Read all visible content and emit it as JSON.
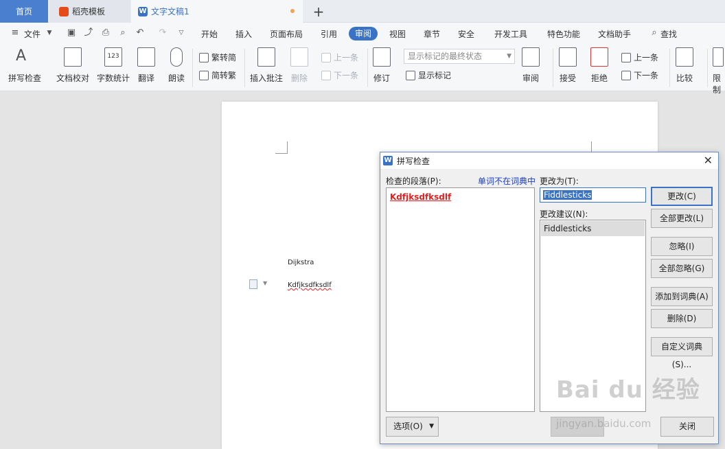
{
  "tabs": {
    "home": "首页",
    "template": "稻壳模板",
    "document": "文字文稿1",
    "add": "+"
  },
  "menu": {
    "file": "文件",
    "items": [
      "开始",
      "插入",
      "页面布局",
      "引用",
      "审阅",
      "视图",
      "章节",
      "安全",
      "开发工具",
      "特色功能",
      "文档助手"
    ],
    "search": "查找"
  },
  "ribbon": {
    "spell_check": "拼写检查",
    "doc_proof": "文档校对",
    "word_count": "字数统计",
    "translate": "翻译",
    "read_aloud": "朗读",
    "trad_to_simp": "繁转简",
    "simp_to_trad": "简转繁",
    "insert_comment": "插入批注",
    "delete": "删除",
    "prev": "上一条",
    "next": "下一条",
    "revise": "修订",
    "markup_select": "显示标记的最终状态",
    "show_markup": "显示标记",
    "review": "审阅",
    "accept": "接受",
    "reject": "拒绝",
    "prev2": "上一条",
    "next2": "下一条",
    "compare": "比较",
    "restrict": "限制"
  },
  "document": {
    "word1": "Dijkstra",
    "word2": "Kdfjksdfksdlf"
  },
  "dialog": {
    "title": "拼写检查",
    "checked_paragraph": "检查的段落(P):",
    "not_in_dict": "单词不在词典中",
    "change_to_label": "更改为(T):",
    "change_to_value": "Fiddlesticks",
    "suggestions_label": "更改建议(N):",
    "suggestions": [
      "Fiddlesticks"
    ],
    "misspelled": "Kdfjksdfksdlf",
    "btn_change": "更改(C)",
    "btn_change_all": "全部更改(L)",
    "btn_ignore": "忽略(I)",
    "btn_ignore_all": "全部忽略(G)",
    "btn_add_dict": "添加到词典(A)",
    "btn_delete": "删除(D)",
    "btn_custom_dict": "自定义词典(S)...",
    "btn_options": "选项(O)",
    "btn_close": "关闭"
  },
  "watermark": {
    "main": "Bai du 经验",
    "url": "jingyan.baidu.com"
  }
}
